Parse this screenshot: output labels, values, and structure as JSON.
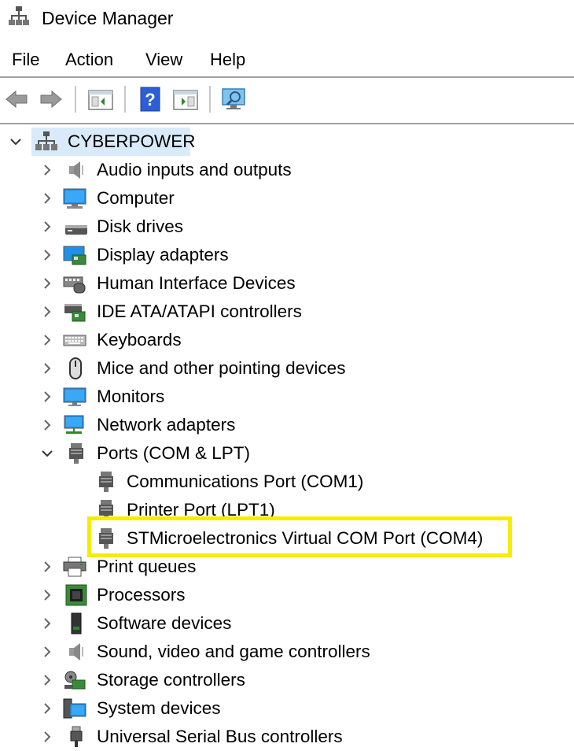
{
  "window": {
    "title": "Device Manager"
  },
  "menu": {
    "file": "File",
    "action": "Action",
    "view": "View",
    "help": "Help"
  },
  "toolbar": {
    "buttons": [
      "back-arrow-icon",
      "forward-arrow-icon",
      "show-hide-console-tree-icon",
      "help-icon",
      "properties-icon",
      "scan-hardware-icon"
    ]
  },
  "tree": {
    "root": {
      "label": "CYBERPOWER",
      "expanded": true,
      "selected": true
    },
    "categories": [
      {
        "label": "Audio inputs and outputs"
      },
      {
        "label": "Computer"
      },
      {
        "label": "Disk drives"
      },
      {
        "label": "Display adapters"
      },
      {
        "label": "Human Interface Devices"
      },
      {
        "label": "IDE ATA/ATAPI controllers"
      },
      {
        "label": "Keyboards"
      },
      {
        "label": "Mice and other pointing devices"
      },
      {
        "label": "Monitors"
      },
      {
        "label": "Network adapters"
      },
      {
        "label": "Ports (COM & LPT)",
        "expanded": true,
        "children": [
          {
            "label": "Communications Port (COM1)"
          },
          {
            "label": "Printer Port (LPT1)"
          },
          {
            "label": "STMicroelectronics Virtual COM Port (COM4)",
            "highlighted": true
          }
        ]
      },
      {
        "label": "Print queues"
      },
      {
        "label": "Processors"
      },
      {
        "label": "Software devices"
      },
      {
        "label": "Sound, video and game controllers"
      },
      {
        "label": "Storage controllers"
      },
      {
        "label": "System devices"
      },
      {
        "label": "Universal Serial Bus controllers"
      }
    ]
  },
  "colors": {
    "highlight_border": "#f7ec00",
    "selection_bg": "#d9ebfa"
  }
}
